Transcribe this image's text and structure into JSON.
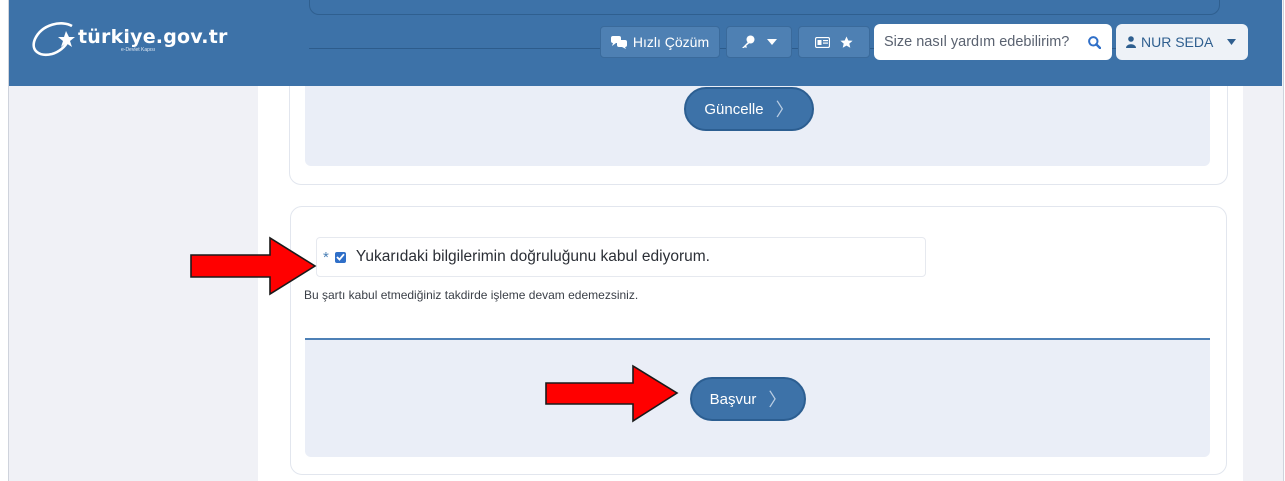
{
  "header": {
    "logo_text": "türkiye.gov.tr",
    "logo_subtext": "e-Devlet Kapısı",
    "quick_solution_label": "Hızlı Çözüm",
    "search": {
      "placeholder": "Size nasıl yardım edebilirim?"
    },
    "user_name": "NUR SEDA"
  },
  "top_panel": {
    "update_button": "Güncelle"
  },
  "confirmation": {
    "required_mark": "*",
    "checkbox_label": "Yukarıdaki bilgilerimin doğruluğunu kabul ediyorum.",
    "checked": true,
    "hint": "Bu şartı kabul etmediğiniz takdirde işleme devam edemezsiniz."
  },
  "submit": {
    "apply_button": "Başvur"
  },
  "icons": [
    "emblem-icon",
    "chat-icon",
    "key-icon",
    "caret-down-icon",
    "id-card-icon",
    "star-icon",
    "search-icon",
    "user-icon",
    "chevron-right-icon",
    "red-arrow-icon"
  ],
  "colors": {
    "header": "#3d72a8",
    "panel_fill": "#eaeef7",
    "arrow": "#ff0000"
  }
}
